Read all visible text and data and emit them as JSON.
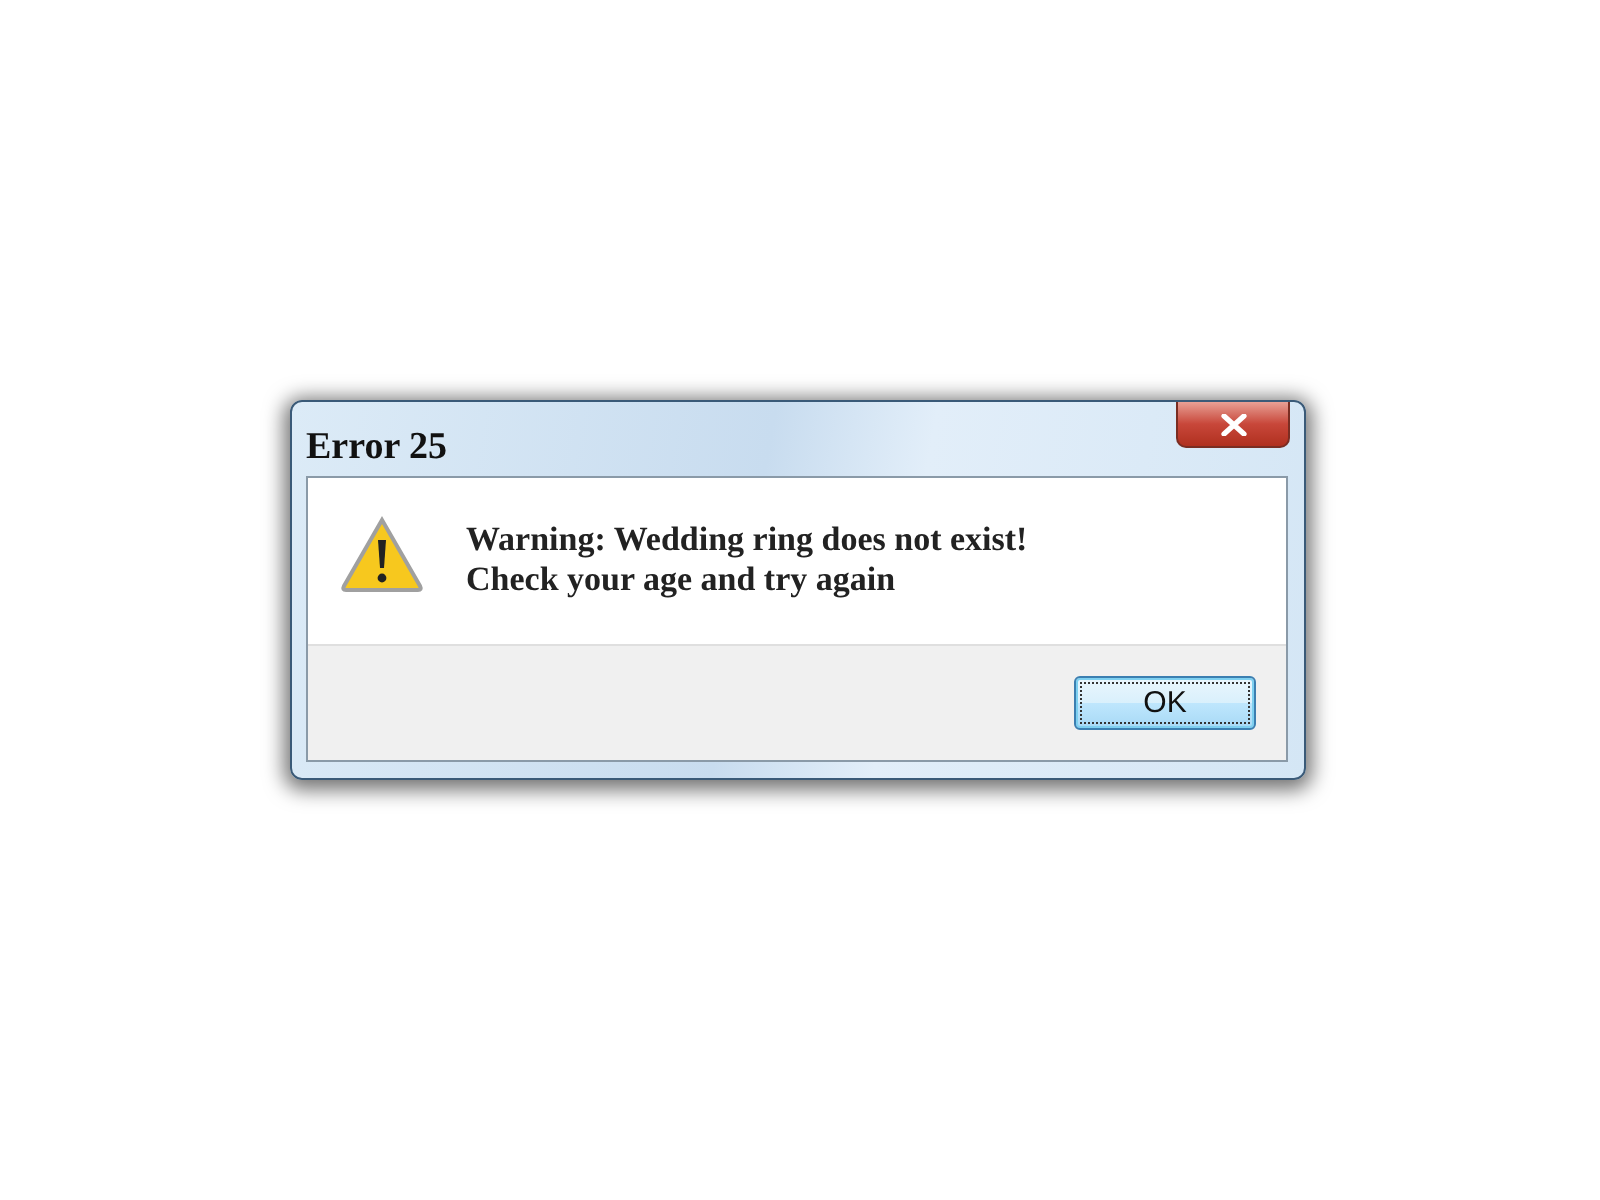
{
  "window": {
    "title": "Error 25"
  },
  "message": {
    "lines": [
      "Warning: Wedding ring does not exist!",
      "Check your age and try again"
    ]
  },
  "buttons": [
    {
      "label": "OK",
      "focused": true
    }
  ]
}
